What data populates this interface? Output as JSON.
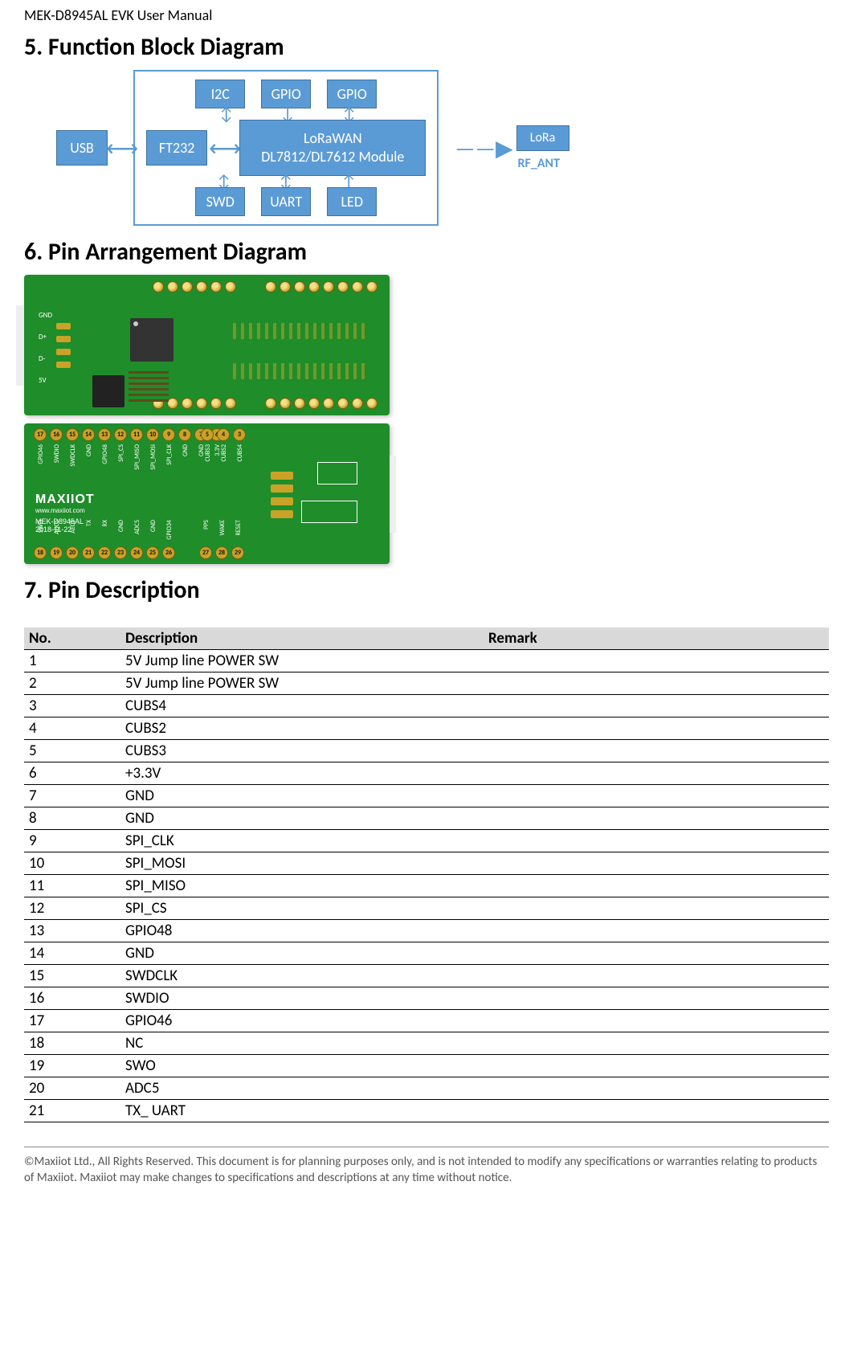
{
  "header": {
    "doc_title": "MEK-D8945AL EVK User Manual"
  },
  "sections": {
    "s5": "5. Function Block Diagram",
    "s6": "6. Pin Arrangement Diagram",
    "s7": "7. Pin Description"
  },
  "block_diagram": {
    "usb": "USB",
    "ft232": "FT232",
    "i2c": "I2C",
    "gpio1": "GPIO",
    "gpio2": "GPIO",
    "main_l1": "LoRaWAN",
    "main_l2": "DL7812/DL7612 Module",
    "swd": "SWD",
    "uart": "UART",
    "led": "LED",
    "lora": "LoRa",
    "rf_ant": "RF_ANT"
  },
  "pcb_bottom": {
    "top_nums": [
      "17",
      "16",
      "15",
      "14",
      "13",
      "12",
      "11",
      "10",
      "9",
      "8",
      "7",
      "6"
    ],
    "top_nums2": [
      "5",
      "4",
      "3"
    ],
    "bot_nums": [
      "18",
      "19",
      "20",
      "21",
      "22",
      "23",
      "24",
      "25",
      "26"
    ],
    "bot_nums2": [
      "27",
      "28",
      "29"
    ],
    "top_labels": [
      "GPIO46",
      "SWDIO",
      "SWDCLK",
      "GND",
      "GPIO48",
      "SPI_CS",
      "SPI_MISO",
      "SPI_MOSI",
      "SPI_CLK",
      "GND",
      "GND",
      "3.3V"
    ],
    "top_labels2": [
      "CUBS3",
      "CUBS2",
      "CUBS4"
    ],
    "bot_labels": [
      "SWO",
      "ADC5",
      "AEC5",
      "TX",
      "RX",
      "GND",
      "ADC5",
      "GND",
      "GPIO34"
    ],
    "bot_labels2": [
      "PPS",
      "WAKE",
      "RESET"
    ],
    "brand": "MAXIIOT",
    "url": "www.maxiiot.com",
    "model": "MEK-D8945AL",
    "date": "2018-11-22"
  },
  "pcb_top": {
    "gnd": "GND",
    "d+": "D+",
    "d-": "D-",
    "5v": "5V"
  },
  "pin_table": {
    "headers": {
      "no": "No.",
      "desc": "Description",
      "remark": "Remark"
    },
    "rows": [
      {
        "no": "1",
        "desc": "5V Jump line   POWER SW",
        "remark": ""
      },
      {
        "no": "2",
        "desc": "5V Jump line   POWER SW",
        "remark": ""
      },
      {
        "no": "3",
        "desc": "CUBS4",
        "remark": ""
      },
      {
        "no": "4",
        "desc": "CUBS2",
        "remark": ""
      },
      {
        "no": "5",
        "desc": "CUBS3",
        "remark": ""
      },
      {
        "no": "6",
        "desc": "+3.3V",
        "remark": ""
      },
      {
        "no": "7",
        "desc": "GND",
        "remark": ""
      },
      {
        "no": "8",
        "desc": "GND",
        "remark": ""
      },
      {
        "no": "9",
        "desc": "SPI_CLK",
        "remark": ""
      },
      {
        "no": "10",
        "desc": "SPI_MOSI",
        "remark": ""
      },
      {
        "no": "11",
        "desc": "SPI_MISO",
        "remark": ""
      },
      {
        "no": "12",
        "desc": "SPI_CS",
        "remark": ""
      },
      {
        "no": "13",
        "desc": "GPIO48",
        "remark": ""
      },
      {
        "no": "14",
        "desc": "GND",
        "remark": ""
      },
      {
        "no": "15",
        "desc": "SWDCLK",
        "remark": ""
      },
      {
        "no": "16",
        "desc": "SWDIO",
        "remark": ""
      },
      {
        "no": "17",
        "desc": "GPIO46",
        "remark": ""
      },
      {
        "no": "18",
        "desc": "NC",
        "remark": ""
      },
      {
        "no": "19",
        "desc": "SWO",
        "remark": ""
      },
      {
        "no": "20",
        "desc": "ADC5",
        "remark": ""
      },
      {
        "no": "21",
        "desc": "TX_ UART",
        "remark": ""
      }
    ]
  },
  "footer": {
    "text": "©Maxiiot Ltd., All Rights Reserved. This document is for planning purposes only, and is not intended to modify any specifications or warranties relating to products of Maxiiot. Maxiiot may make changes to specifications and descriptions at any time without notice."
  }
}
